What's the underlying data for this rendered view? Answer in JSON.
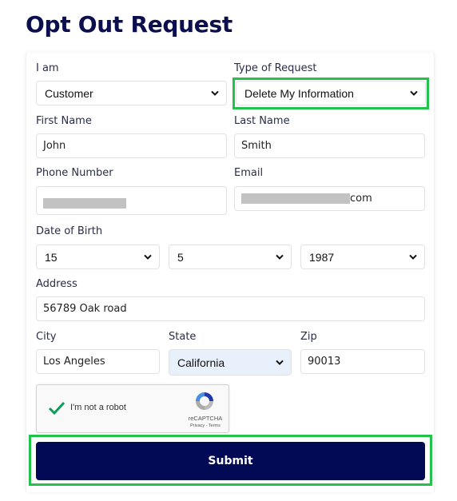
{
  "page": {
    "title": "Opt Out Request"
  },
  "colors": {
    "title": "#0b0f4d",
    "submit_bg": "#030a55",
    "highlight_outline": "#22c24b",
    "autofill_bg": "#e8f0fc"
  },
  "form": {
    "i_am": {
      "label": "I am",
      "value": "Customer"
    },
    "request_type": {
      "label": "Type of Request",
      "value": "Delete My Information"
    },
    "first_name": {
      "label": "First Name",
      "value": "John"
    },
    "last_name": {
      "label": "Last Name",
      "value": "Smith"
    },
    "phone": {
      "label": "Phone Number",
      "value": "[redacted]"
    },
    "email": {
      "label": "Email",
      "value_suffix": "com"
    },
    "dob": {
      "label": "Date of Birth",
      "day": "15",
      "month": "5",
      "year": "1987"
    },
    "address": {
      "label": "Address",
      "value": "56789 Oak road"
    },
    "city": {
      "label": "City",
      "value": "Los Angeles"
    },
    "state": {
      "label": "State",
      "value": "California"
    },
    "zip": {
      "label": "Zip",
      "value": "90013"
    },
    "captcha": {
      "label": "I'm not a robot",
      "brand": "reCAPTCHA",
      "links": "Privacy - Terms",
      "checked": true
    },
    "submit_label": "Submit"
  }
}
